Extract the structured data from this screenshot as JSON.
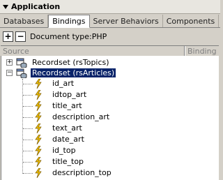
{
  "panel": {
    "title": "Application"
  },
  "tabs": [
    {
      "label": "Databases"
    },
    {
      "label": "Bindings"
    },
    {
      "label": "Server Behaviors"
    },
    {
      "label": "Components"
    }
  ],
  "toolbar": {
    "add_label": "+",
    "remove_label": "−",
    "doctype_label": "Document type:PHP"
  },
  "columns": {
    "source": "Source",
    "binding": "Binding"
  },
  "tree": {
    "recordsets": [
      {
        "label": "Recordset (rsTopics)",
        "expanded": false,
        "selected": false
      },
      {
        "label": "Recordset (rsArticles)",
        "expanded": true,
        "selected": true
      }
    ],
    "fields": [
      "id_art",
      "idtop_art",
      "title_art",
      "description_art",
      "text_art",
      "date_art",
      "id_top",
      "title_top",
      "description_top"
    ]
  },
  "colors": {
    "selection": "#0a246a",
    "bolt": "#f4c400"
  }
}
